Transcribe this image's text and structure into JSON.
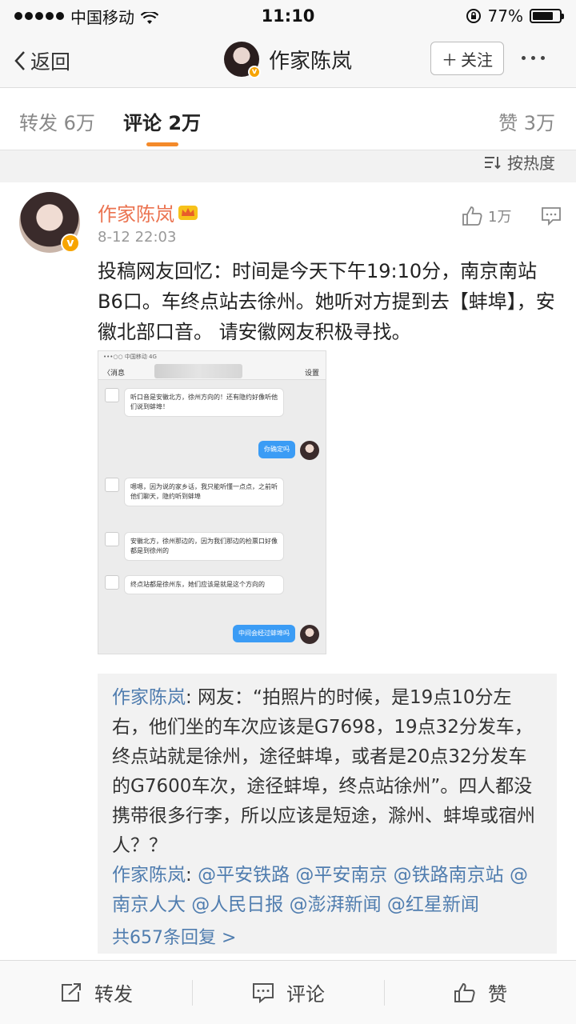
{
  "status_bar": {
    "carrier": "中国移动",
    "time": "11:10",
    "battery": "77%",
    "battery_level": 0.77
  },
  "nav": {
    "back_label": "返回",
    "title": "作家陈岚",
    "follow_label": "关注"
  },
  "tabs": {
    "repost": "转发 6万",
    "comment": "评论 2万",
    "like": "赞 3万"
  },
  "sort_label": "按热度",
  "comment": {
    "author": "作家陈岚",
    "time": "8-12 22:03",
    "likes": "1万",
    "text": "投稿网友回忆：时间是今天下午19:10分，南京南站B6口。车终点站去徐州。她听对方提到去【蚌埠】，安徽北部口音。 请安徽网友积极寻找。"
  },
  "chat_image": {
    "status": "•••○○ 中国移动 4G",
    "back": "〈消息",
    "settings": "设置",
    "messages": [
      {
        "from": "other",
        "text": "听口音是安徽北方，徐州方向的！还有隐约好像听他们说到蚌埠！"
      },
      {
        "from": "me",
        "text": "你确定吗"
      },
      {
        "from": "other",
        "text": "嗯嗯，因为说的家乡话，我只能听懂一点点，之前听他们聊天，隐约听到蚌埠"
      },
      {
        "from": "other",
        "text": "安徽北方，徐州那边的，因为我们那边的检票口好像都是到徐州的"
      },
      {
        "from": "other",
        "text": "终点站都是徐州东，她们应该是就是这个方向的"
      },
      {
        "from": "me",
        "text": "中间会经过蚌埠吗"
      }
    ]
  },
  "replies": [
    {
      "name": "作家陈岚",
      "text": ": 网友：“拍照片的时候，是19点10分左右，他们坐的车次应该是G7698，19点32分发车，终点站就是徐州，途径蚌埠，或者是20点32分发车的G7600车次，途径蚌埠，终点站徐州”。四人都没携带很多行李，所以应该是短途，滁州、蚌埠或宿州人？？"
    },
    {
      "name": "作家陈岚",
      "text": ": ",
      "mentions": "@平安铁路 @平安南京 @铁路南京站 @南京人大 @人民日报 @澎湃新闻 @红星新闻"
    }
  ],
  "more_replies": "共657条回复 >",
  "toolbar": {
    "repost": "转发",
    "comment": "评论",
    "like": "赞"
  }
}
